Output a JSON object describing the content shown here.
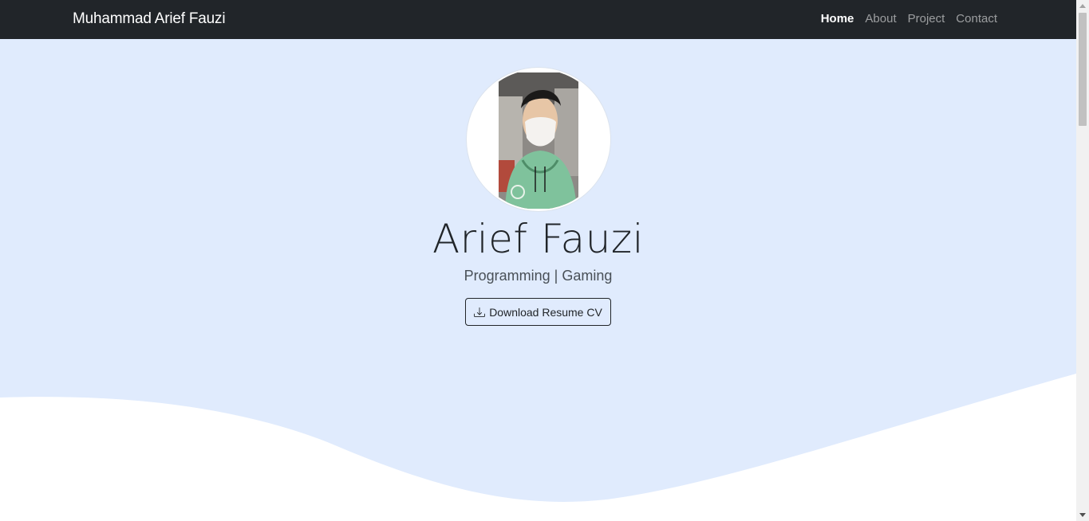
{
  "navbar": {
    "brand": "Muhammad Arief Fauzi",
    "links": [
      {
        "label": "Home",
        "active": true
      },
      {
        "label": "About",
        "active": false
      },
      {
        "label": "Project",
        "active": false
      },
      {
        "label": "Contact",
        "active": false
      }
    ]
  },
  "hero": {
    "name": "Arief Fauzi",
    "tagline": "Programming | Gaming",
    "cv_button": {
      "label": "Download Resume CV",
      "icon": "download-icon"
    }
  },
  "colors": {
    "navbar_bg": "#212529",
    "hero_bg": "#e0ebfd",
    "text_dark": "#212529"
  }
}
